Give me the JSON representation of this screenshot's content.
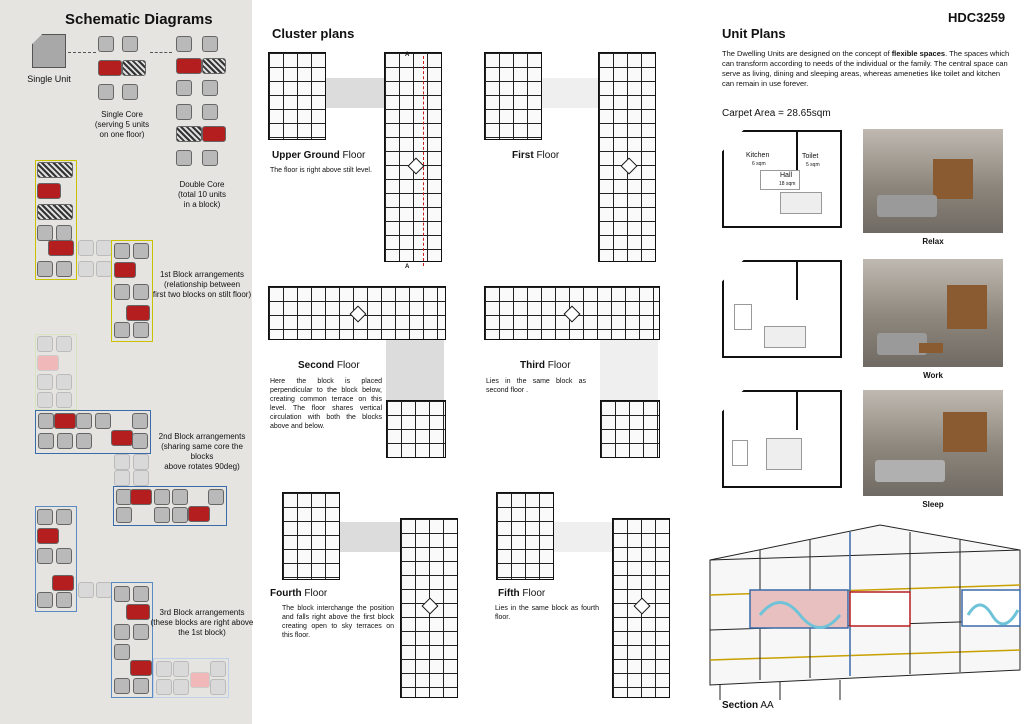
{
  "project_code": "HDC3259",
  "left": {
    "title": "Schematic Diagrams",
    "single_unit": "Single Unit",
    "single_core": "Single Core\n(serving 5 units\non one floor)",
    "double_core": "Double Core\n(total 10 units\nin a block)",
    "block1": "1st Block arrangements\n(relationship between\nfirst two blocks on stilt floor)",
    "block2": "2nd Block arrangements\n(sharing same core the blocks\nabove rotates 90deg)",
    "block3": "3rd Block arrangements\n(these blocks are right above\nthe 1st block)"
  },
  "cluster": {
    "title": "Cluster plans",
    "section_marker": "A",
    "upper_ground": {
      "bold": "Upper Ground",
      "rest": " Floor",
      "desc": "The floor is right above stilt level."
    },
    "first": {
      "bold": "First",
      "rest": " Floor",
      "desc": ""
    },
    "second": {
      "bold": "Second",
      "rest": " Floor",
      "desc": "Here the block is placed perpendicular to the block below, creating common terrace on this level. The floor shares vertical circulation with both the blocks above and below."
    },
    "third": {
      "bold": "Third",
      "rest": " Floor",
      "desc": "Lies in the same block as second floor ."
    },
    "fourth": {
      "bold": "Fourth",
      "rest": " Floor",
      "desc": "The block interchange the position and falls right above the first block creating open to sky terraces on this floor."
    },
    "fifth": {
      "bold": "Fifth",
      "rest": " Floor",
      "desc": "Lies in the same block as fourth floor."
    }
  },
  "unit": {
    "title": "Unit Plans",
    "intro_pre": "The Dwelling Units are designed on the concept of ",
    "intro_bold": "flexible spaces",
    "intro_post": ". The spaces which can transform according to needs of the individual or the family. The central space can serve as living, dining and sleeping areas, whereas ameneties like toilet and kitchen can remain in use forever.",
    "carpet_area": "Carpet Area = 28.65sqm",
    "kitchen": "Kitchen",
    "kitchen_area": "6 sqm",
    "toilet": "Toilet",
    "toilet_area": "5 sqm",
    "hall": "Hall",
    "hall_area": "18 sqm",
    "captions": [
      "Relax",
      "Work",
      "Sleep"
    ]
  },
  "section": {
    "bold": "Section",
    "rest": " AA"
  }
}
